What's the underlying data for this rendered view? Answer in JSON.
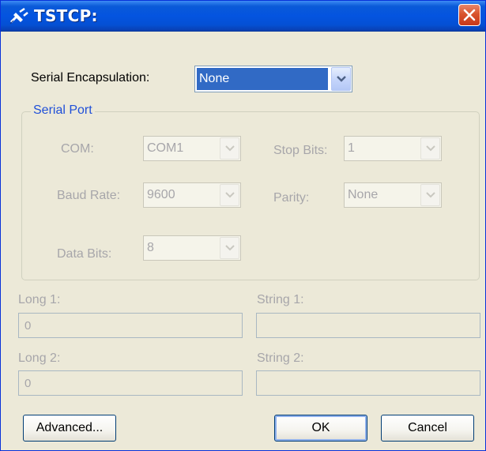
{
  "window": {
    "title": "TSTCP:",
    "icons": {
      "app": "plug-icon",
      "close": "close-icon"
    }
  },
  "serial_encapsulation": {
    "label": "Serial Encapsulation:",
    "value": "None"
  },
  "serial_port": {
    "legend": "Serial Port",
    "com": {
      "label": "COM:",
      "value": "COM1"
    },
    "baud_rate": {
      "label": "Baud Rate:",
      "value": "9600"
    },
    "data_bits": {
      "label": "Data Bits:",
      "value": "8"
    },
    "stop_bits": {
      "label": "Stop Bits:",
      "value": "1"
    },
    "parity": {
      "label": "Parity:",
      "value": "None"
    }
  },
  "fields": {
    "long1": {
      "label": "Long 1:",
      "value": "0"
    },
    "long2": {
      "label": "Long 2:",
      "value": "0"
    },
    "string1": {
      "label": "String 1:",
      "value": ""
    },
    "string2": {
      "label": "String 2:",
      "value": ""
    }
  },
  "buttons": {
    "advanced": "Advanced...",
    "ok": "OK",
    "cancel": "Cancel"
  },
  "colors": {
    "titlebar": "#0454e0",
    "selection": "#316ac5",
    "group_legend": "#2050d8",
    "disabled_text": "#a7a6aa"
  }
}
